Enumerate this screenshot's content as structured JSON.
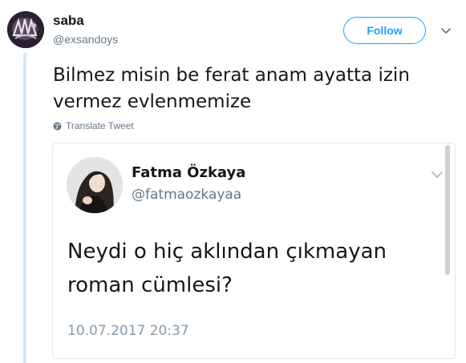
{
  "tweet": {
    "user": {
      "display_name": "saba",
      "handle": "@exsandoys",
      "avatar_icon": "profile-photo"
    },
    "follow_label": "Follow",
    "more_icon": "chevron-down-icon",
    "text": "Bilmez misin be ferat anam ayatta izin vermez evlenmemize",
    "translate_label": "Translate Tweet",
    "translate_icon": "globe-icon"
  },
  "quoted_tweet": {
    "user": {
      "display_name": "Fatma Özkaya",
      "handle": "@fatmaozkayaa",
      "avatar_icon": "profile-photo"
    },
    "more_icon": "chevron-down-icon",
    "text": "Neydi o hiç aklından çıkmayan roman cümlesi?",
    "date": "10.07.2017 20:37"
  },
  "colors": {
    "accent": "#1da1f2",
    "text_primary": "#14171a",
    "text_secondary": "#657786",
    "thread_line": "#cfe7f6",
    "card_border": "#e1e8ed"
  }
}
